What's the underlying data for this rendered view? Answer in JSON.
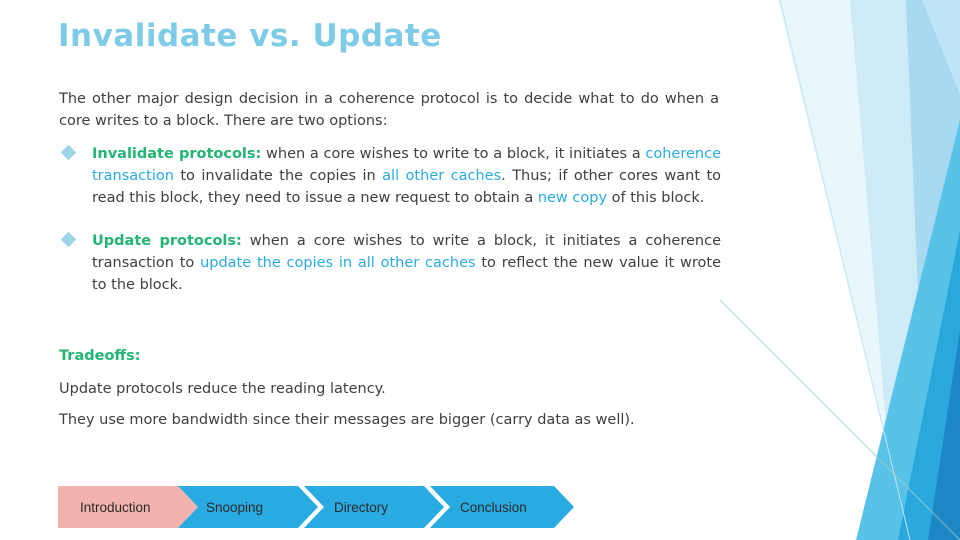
{
  "slide": {
    "title": "Invalidate vs. Update",
    "intro": "The other major design decision in a coherence protocol is to decide what to do when a core writes to a block. There are two options:",
    "bullets": [
      {
        "lead": "Invalidate protocols:",
        "seg1": " when a core wishes to write to a block, it initiates a ",
        "hl1": "coherence transaction",
        "seg2": " to invalidate the copies in ",
        "hl2": "all other caches",
        "seg3": ". Thus; if other cores want to read this block, they need to issue a new request to obtain a ",
        "hl3": "new copy",
        "seg4": " of this block."
      },
      {
        "lead": "Update protocols:",
        "seg1": " when a core wishes to write a block, it initiates a coherence transaction to ",
        "hl1": "update the copies in all other caches",
        "seg2": " to reflect the new value it wrote to the block.",
        "hl2": "",
        "seg3": "",
        "hl3": "",
        "seg4": ""
      }
    ],
    "tradeoffs_heading": "Tradeoffs:",
    "tradeoff_lines": [
      "Update protocols reduce the reading latency.",
      "They use more bandwidth since their messages are bigger (carry data as well)."
    ],
    "nav": [
      {
        "label": "Introduction",
        "state": "active"
      },
      {
        "label": "Snooping",
        "state": "normal"
      },
      {
        "label": "Directory",
        "state": "normal"
      },
      {
        "label": "Conclusion",
        "state": "normal"
      }
    ],
    "colors": {
      "title": "#7ecbe8",
      "lead": "#22b573",
      "highlight": "#29abe2",
      "body": "#3f3f3f",
      "nav_active_fill": "#f2b3ae",
      "nav_fill": "#29abe2",
      "bullet_marker": "#9fd3e8"
    }
  }
}
